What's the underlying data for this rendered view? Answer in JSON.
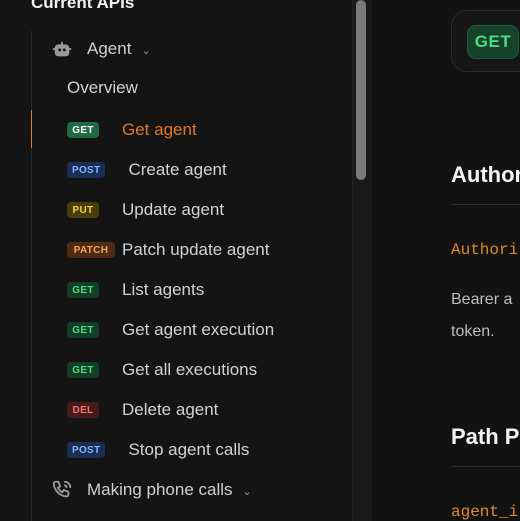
{
  "sidebar": {
    "section_title": "Current APIs",
    "groups": [
      {
        "label": "Agent",
        "icon": "robot-icon"
      },
      {
        "label": "Making phone calls",
        "icon": "phone-icon"
      }
    ],
    "overview_label": "Overview",
    "items": [
      {
        "method": "GET",
        "label": "Get agent",
        "active": true
      },
      {
        "method": "POST",
        "label": "Create agent"
      },
      {
        "method": "PUT",
        "label": "Update agent"
      },
      {
        "method": "PATCH",
        "label": "Patch update agent"
      },
      {
        "method": "GET",
        "label": "List agents"
      },
      {
        "method": "GET",
        "label": "Get agent execution"
      },
      {
        "method": "GET",
        "label": "Get all executions"
      },
      {
        "method": "DEL",
        "label": "Delete agent"
      },
      {
        "method": "POST",
        "label": "Stop agent calls"
      }
    ]
  },
  "content": {
    "method": "GET",
    "auth_heading": "Author",
    "auth_code": "Authori",
    "auth_text_line1": "Bearer a",
    "auth_text_line2": "token.",
    "path_heading": "Path P",
    "path_code": "agent_i"
  },
  "colors": {
    "accent": "#e07a1f",
    "get": "#4ade80",
    "post": "#7fb2ff",
    "put": "#f5d33a",
    "patch": "#f2a35a",
    "del": "#f27373"
  }
}
